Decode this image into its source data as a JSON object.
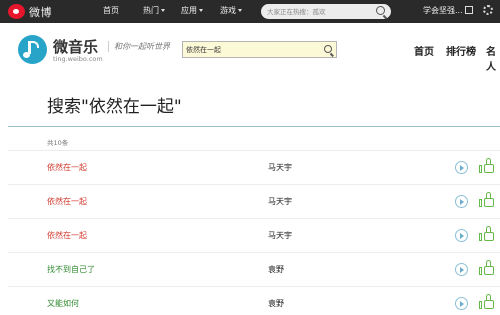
{
  "weibo_bar": {
    "logo_text": "微博",
    "nav": [
      {
        "label": "首页",
        "dropdown": false
      },
      {
        "label": "热门",
        "dropdown": true
      },
      {
        "label": "应用",
        "dropdown": true
      },
      {
        "label": "游戏",
        "dropdown": true
      }
    ],
    "search_placeholder": "大家正在热搜：孤欢",
    "user_name": "学会坚强..."
  },
  "music_header": {
    "brand": "微音乐",
    "domain": "ting.weibo.com",
    "slogan": "和你一起听世界",
    "search_value": "依然在一起",
    "nav": [
      "首页",
      "排行榜",
      "名人"
    ]
  },
  "results": {
    "title": "搜索\"依然在一起\"",
    "count_text": "共10条",
    "rows": [
      {
        "song": "依然在一起",
        "artist": "马天宇",
        "color": "#d0382b"
      },
      {
        "song": "依然在一起",
        "artist": "马天宇",
        "color": "#d0382b"
      },
      {
        "song": "依然在一起",
        "artist": "马天宇",
        "color": "#d0382b"
      },
      {
        "song": "找不到自己了",
        "artist": "袁野",
        "color": "#2f8a2f"
      },
      {
        "song": "又能如何",
        "artist": "袁野",
        "color": "#2f8a2f"
      }
    ]
  },
  "colors": {
    "topbar_bg": "#2a2a2a",
    "accent_blue": "#29a4c9",
    "like_green": "#67b84b"
  }
}
